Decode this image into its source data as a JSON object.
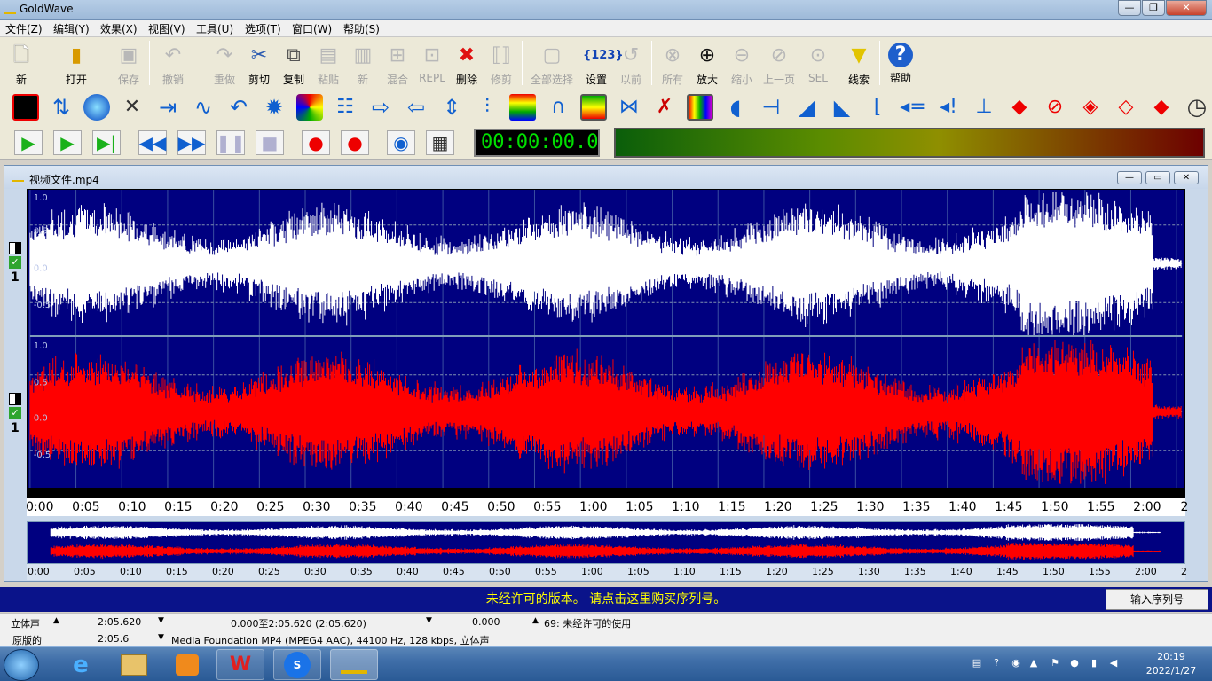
{
  "window": {
    "title": "GoldWave",
    "controls": [
      "—",
      "❐",
      "✕"
    ]
  },
  "menu": [
    "文件(Z)",
    "编辑(Y)",
    "效果(X)",
    "视图(V)",
    "工具(U)",
    "选项(T)",
    "窗口(W)",
    "帮助(S)"
  ],
  "toolbar": [
    {
      "label": "新",
      "icon": "new-file-icon",
      "enabled": true
    },
    {
      "label": "打开",
      "icon": "open-folder-icon",
      "enabled": true
    },
    {
      "label": "保存",
      "icon": "save-icon",
      "enabled": false
    },
    {
      "label": "撤销",
      "icon": "undo-icon",
      "enabled": false
    },
    {
      "label": "重做",
      "icon": "redo-icon",
      "enabled": false
    },
    {
      "label": "剪切",
      "icon": "scissors-icon",
      "enabled": true
    },
    {
      "label": "复制",
      "icon": "copy-icon",
      "enabled": true
    },
    {
      "label": "粘贴",
      "icon": "paste-icon",
      "enabled": false
    },
    {
      "label": "新",
      "icon": "paste-new-icon",
      "enabled": false
    },
    {
      "label": "混合",
      "icon": "mix-icon",
      "enabled": false
    },
    {
      "label": "REPL",
      "icon": "replace-icon",
      "enabled": false
    },
    {
      "label": "删除",
      "icon": "delete-icon",
      "enabled": true
    },
    {
      "label": "修剪",
      "icon": "trim-icon",
      "enabled": false
    },
    {
      "label": "全部选择",
      "icon": "select-all-icon",
      "enabled": false
    },
    {
      "label": "设置",
      "icon": "set-marker-icon",
      "enabled": true
    },
    {
      "label": "以前",
      "icon": "previous-icon",
      "enabled": false
    },
    {
      "label": "所有",
      "icon": "zoom-all-icon",
      "enabled": false
    },
    {
      "label": "放大",
      "icon": "zoom-in-icon",
      "enabled": true
    },
    {
      "label": "缩小",
      "icon": "zoom-out-icon",
      "enabled": false
    },
    {
      "label": "上一页",
      "icon": "zoom-previous-icon",
      "enabled": false
    },
    {
      "label": "SEL",
      "icon": "zoom-selection-icon",
      "enabled": false
    },
    {
      "label": "线索",
      "icon": "cue-icon",
      "enabled": true
    },
    {
      "label": "帮助",
      "icon": "help-icon",
      "enabled": true
    }
  ],
  "transport": {
    "time": "00:00:00.0"
  },
  "document": {
    "title": "视频文件.mp4",
    "channel_marker": "1"
  },
  "wave_axis": {
    "labels": [
      "1.0",
      "0.5",
      "0.0",
      "-0.5",
      "1.0",
      "0.5",
      "0.0",
      "-0.5"
    ]
  },
  "timeline": [
    "0:00",
    "0:05",
    "0:10",
    "0:15",
    "0:20",
    "0:25",
    "0:30",
    "0:35",
    "0:40",
    "0:45",
    "0:50",
    "0:55",
    "1:00",
    "1:05",
    "1:10",
    "1:15",
    "1:20",
    "1:25",
    "1:30",
    "1:35",
    "1:40",
    "1:45",
    "1:50",
    "1:55",
    "2:00",
    "2"
  ],
  "overview_timeline": [
    "0:00",
    "0:05",
    "0:10",
    "0:15",
    "0:20",
    "0:25",
    "0:30",
    "0:35",
    "0:40",
    "0:45",
    "0:50",
    "0:55",
    "1:00",
    "1:05",
    "1:10",
    "1:15",
    "1:20",
    "1:25",
    "1:30",
    "1:35",
    "1:40",
    "1:45",
    "1:50",
    "1:55",
    "2:00",
    "2"
  ],
  "banner": {
    "text": "未经许可的版本。 请点击这里购买序列号。",
    "button": "输入序列号"
  },
  "status": {
    "channels": "立体声",
    "length": "2:05.620",
    "selection": "0.000至2:05.620 (2:05.620)",
    "position": "0.000",
    "message": "69: 未经许可的使用",
    "original": "原版的",
    "orig_length": "2:05.6",
    "format": "Media Foundation MP4 (MPEG4 AAC), 44100 Hz, 128 kbps, 立体声"
  },
  "taskbar": {
    "time": "20:19",
    "date": "2022/1/27"
  },
  "colors": {
    "wave_bg": "#000080",
    "left_channel": "#ffffff",
    "right_channel": "#ff0000",
    "banner_text": "#ffff00"
  }
}
